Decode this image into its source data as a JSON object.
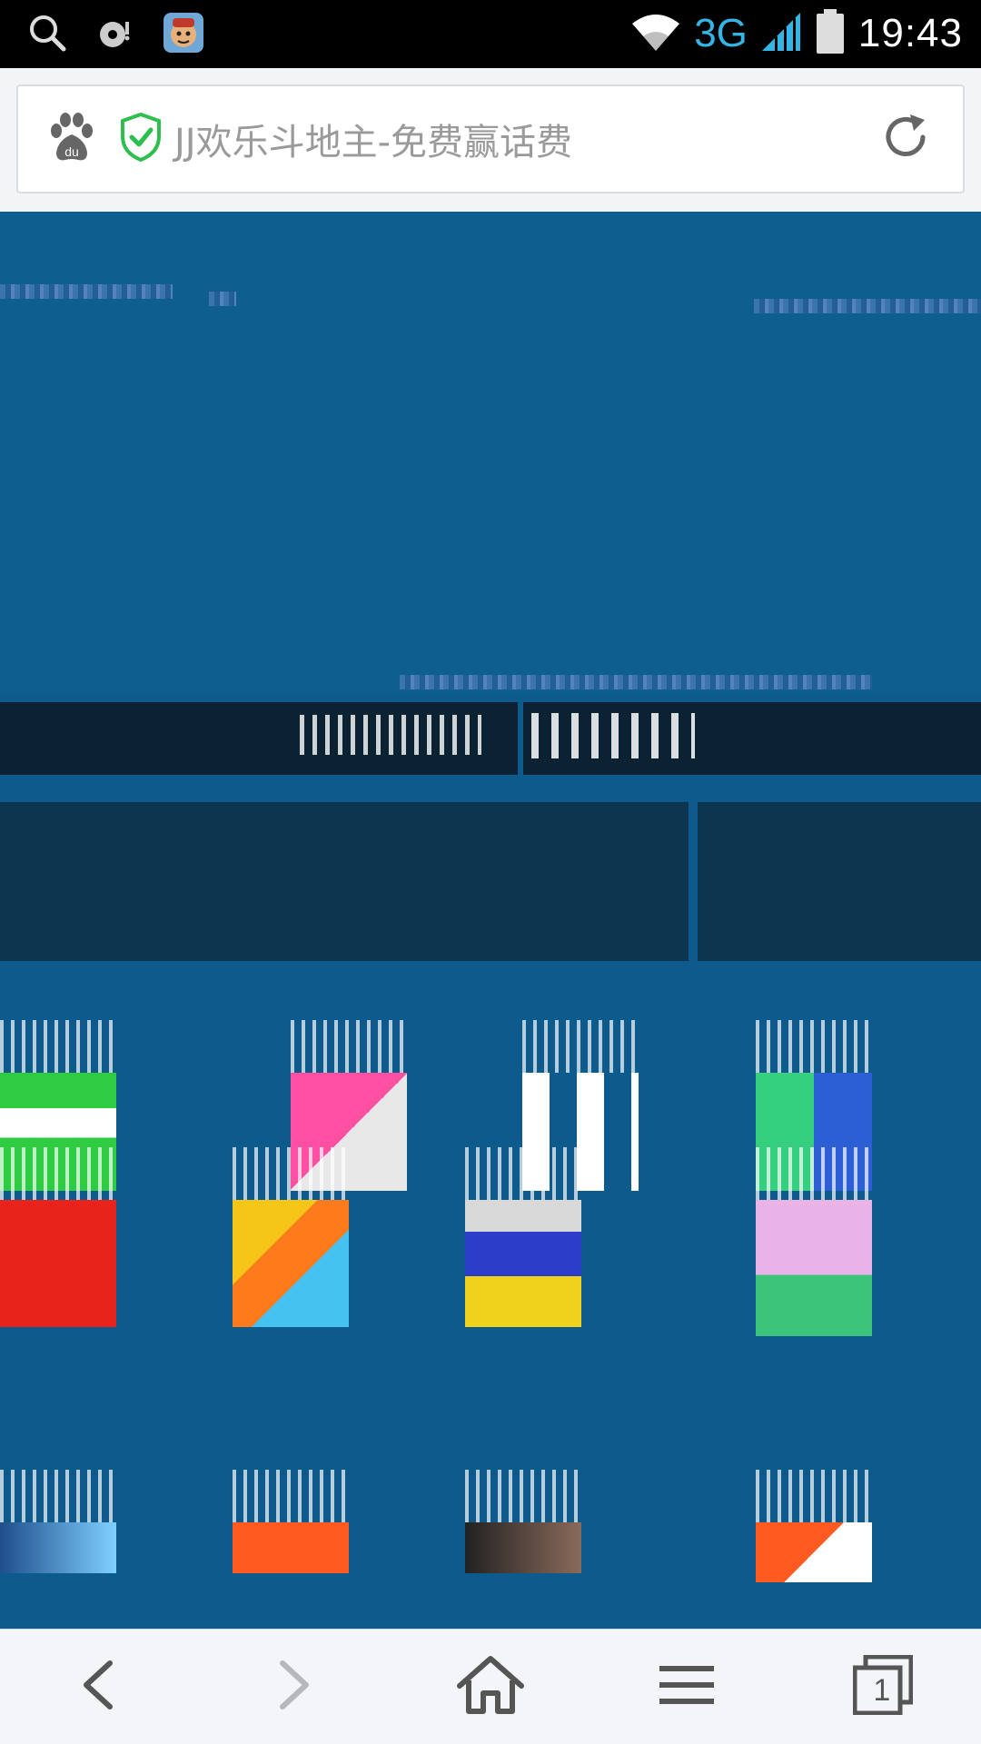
{
  "status_bar": {
    "network": "3G",
    "time": "19:43",
    "icons": [
      "search-icon",
      "podcast-icon",
      "app-avatar-icon",
      "wifi-icon",
      "signal-icon",
      "battery-icon"
    ]
  },
  "address_bar": {
    "page_title": "JJ欢乐斗地主-免费赢话费",
    "icons": [
      "baidu-paw-icon",
      "secure-shield-icon",
      "refresh-icon"
    ]
  },
  "bottom_nav": {
    "tab_count": "1",
    "icons": [
      "back-icon",
      "forward-icon",
      "home-icon",
      "menu-icon",
      "tabs-icon"
    ]
  },
  "colors": {
    "accent_blue": "#33b5e5",
    "shield_green": "#2dbf4d",
    "page_bg": "#0d5b8c"
  }
}
